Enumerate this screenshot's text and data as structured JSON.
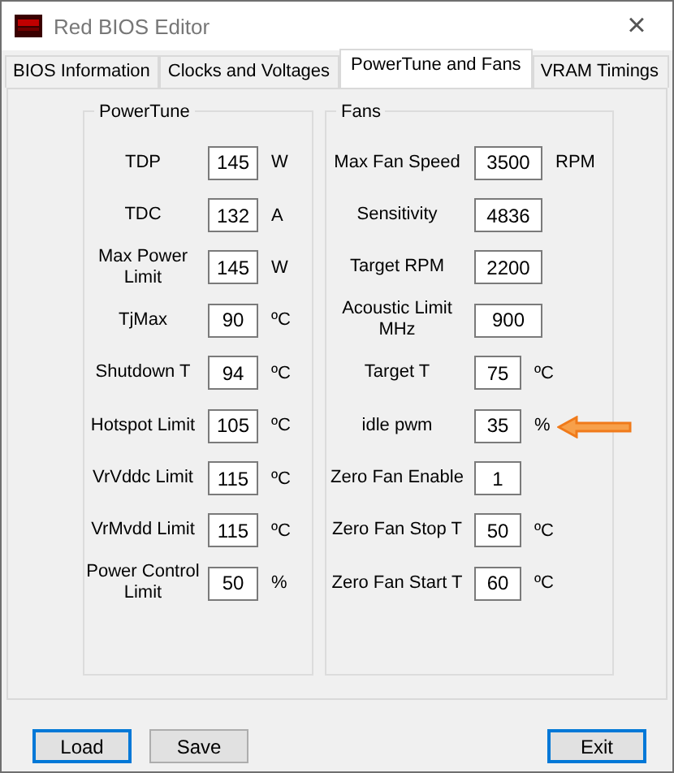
{
  "window": {
    "title": "Red BIOS Editor",
    "close": "×"
  },
  "tabs": [
    {
      "label": "BIOS Information",
      "selected": false
    },
    {
      "label": "Clocks and Voltages",
      "selected": false
    },
    {
      "label": "PowerTune and Fans",
      "selected": true
    },
    {
      "label": "VRAM Timings",
      "selected": false
    }
  ],
  "groups": [
    {
      "title": "PowerTune",
      "fields": [
        {
          "label": "TDP",
          "value": "145",
          "unit": "W",
          "arrow": false
        },
        {
          "label": "TDC",
          "value": "132",
          "unit": "A",
          "arrow": false
        },
        {
          "label": "Max Power Limit",
          "value": "145",
          "unit": "W",
          "arrow": false
        },
        {
          "label": "TjMax",
          "value": "90",
          "unit": "ºC",
          "arrow": false
        },
        {
          "label": "Shutdown T",
          "value": "94",
          "unit": "ºC",
          "arrow": false
        },
        {
          "label": "Hotspot Limit",
          "value": "105",
          "unit": "ºC",
          "arrow": false
        },
        {
          "label": "VrVddc Limit",
          "value": "115",
          "unit": "ºC",
          "arrow": false
        },
        {
          "label": "VrMvdd Limit",
          "value": "115",
          "unit": "ºC",
          "arrow": false
        },
        {
          "label": "Power Control Limit",
          "value": "50",
          "unit": "%",
          "arrow": false
        }
      ]
    },
    {
      "title": "Fans",
      "fields": [
        {
          "label": "Max Fan Speed",
          "value": "3500",
          "unit": "RPM",
          "arrow": false
        },
        {
          "label": "Sensitivity",
          "value": "4836",
          "arrow": false
        },
        {
          "label": "Target RPM",
          "value": "2200",
          "arrow": false
        },
        {
          "label": "Acoustic Limit MHz",
          "value": "900",
          "arrow": false
        },
        {
          "label": "Target T",
          "value": "75",
          "unit": "ºC",
          "arrow": false
        },
        {
          "label": "idle pwm",
          "value": "35",
          "unit": "%",
          "arrow": true
        },
        {
          "label": "Zero Fan Enable",
          "value": "1",
          "arrow": false
        },
        {
          "label": "Zero Fan Stop T",
          "value": "50",
          "unit": "ºC",
          "arrow": false
        },
        {
          "label": "Zero Fan Start T",
          "value": "60",
          "unit": "ºC",
          "arrow": false
        }
      ]
    }
  ],
  "buttons": [
    {
      "label": "Load",
      "focused": true
    },
    {
      "label": "Save",
      "focused": false
    },
    {
      "label": "Exit",
      "focused": true
    }
  ]
}
